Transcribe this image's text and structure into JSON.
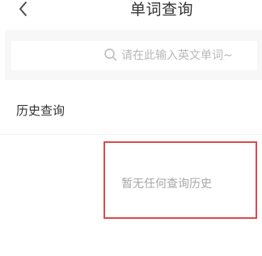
{
  "header": {
    "back_icon": "chevron-left-icon",
    "title": "单词查询"
  },
  "search": {
    "icon": "search-icon",
    "placeholder": "请在此输入英文单词~",
    "value": ""
  },
  "history": {
    "title": "历史查询",
    "empty_message": "暂无任何查询历史"
  },
  "colors": {
    "background": "#ffffff",
    "search_band": "#f7f7f7",
    "text_primary": "#333333",
    "text_muted": "#a6a6a6",
    "highlight_border": "#dc4a4a"
  }
}
